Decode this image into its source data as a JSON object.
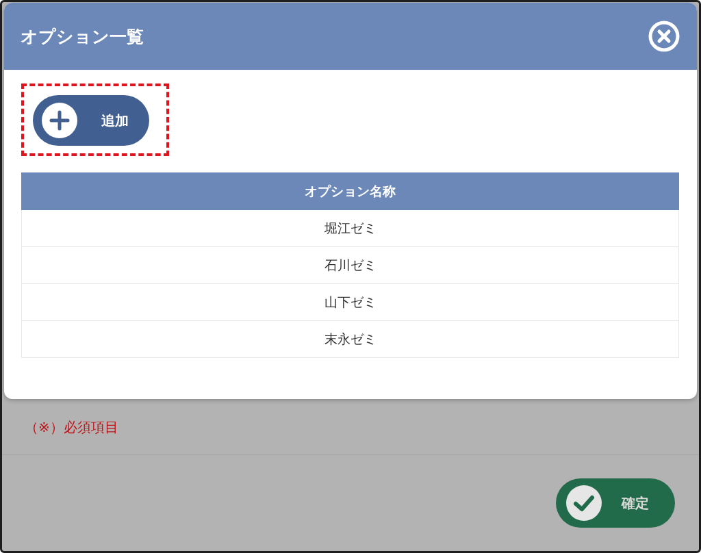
{
  "dialog": {
    "title": "オプション一覧",
    "add_button": {
      "label": "追加",
      "highlighted": true
    },
    "table": {
      "columns": [
        "オプション名称"
      ],
      "rows": [
        [
          "堀江ゼミ"
        ],
        [
          "石川ゼミ"
        ],
        [
          "山下ゼミ"
        ],
        [
          "末永ゼミ"
        ]
      ]
    }
  },
  "background": {
    "required_note": "（※）必須項目",
    "confirm_button": {
      "label": "確定"
    }
  }
}
